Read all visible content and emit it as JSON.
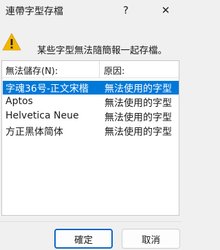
{
  "window": {
    "title": "連帶字型存檔",
    "help_glyph": "?",
    "close_glyph": "✕"
  },
  "icons": {
    "warning": "warning-triangle-icon"
  },
  "message": "某些字型無法隨簡報一起存檔。",
  "list": {
    "headers": {
      "font": "無法儲存(N):",
      "reason": "原因:"
    },
    "rows": [
      {
        "font": "字魂36号-正文宋楷",
        "reason": "無法使用的字型",
        "selected": true
      },
      {
        "font": "Aptos",
        "reason": "無法使用的字型",
        "selected": false
      },
      {
        "font": "Helvetica Neue",
        "reason": "無法使用的字型",
        "selected": false
      },
      {
        "font": "方正黑体简体",
        "reason": "無法使用的字型",
        "selected": false
      }
    ]
  },
  "buttons": {
    "ok": "確定",
    "cancel": "取消"
  },
  "colors": {
    "selection": "#0078d7",
    "warning": "#f2b600"
  }
}
